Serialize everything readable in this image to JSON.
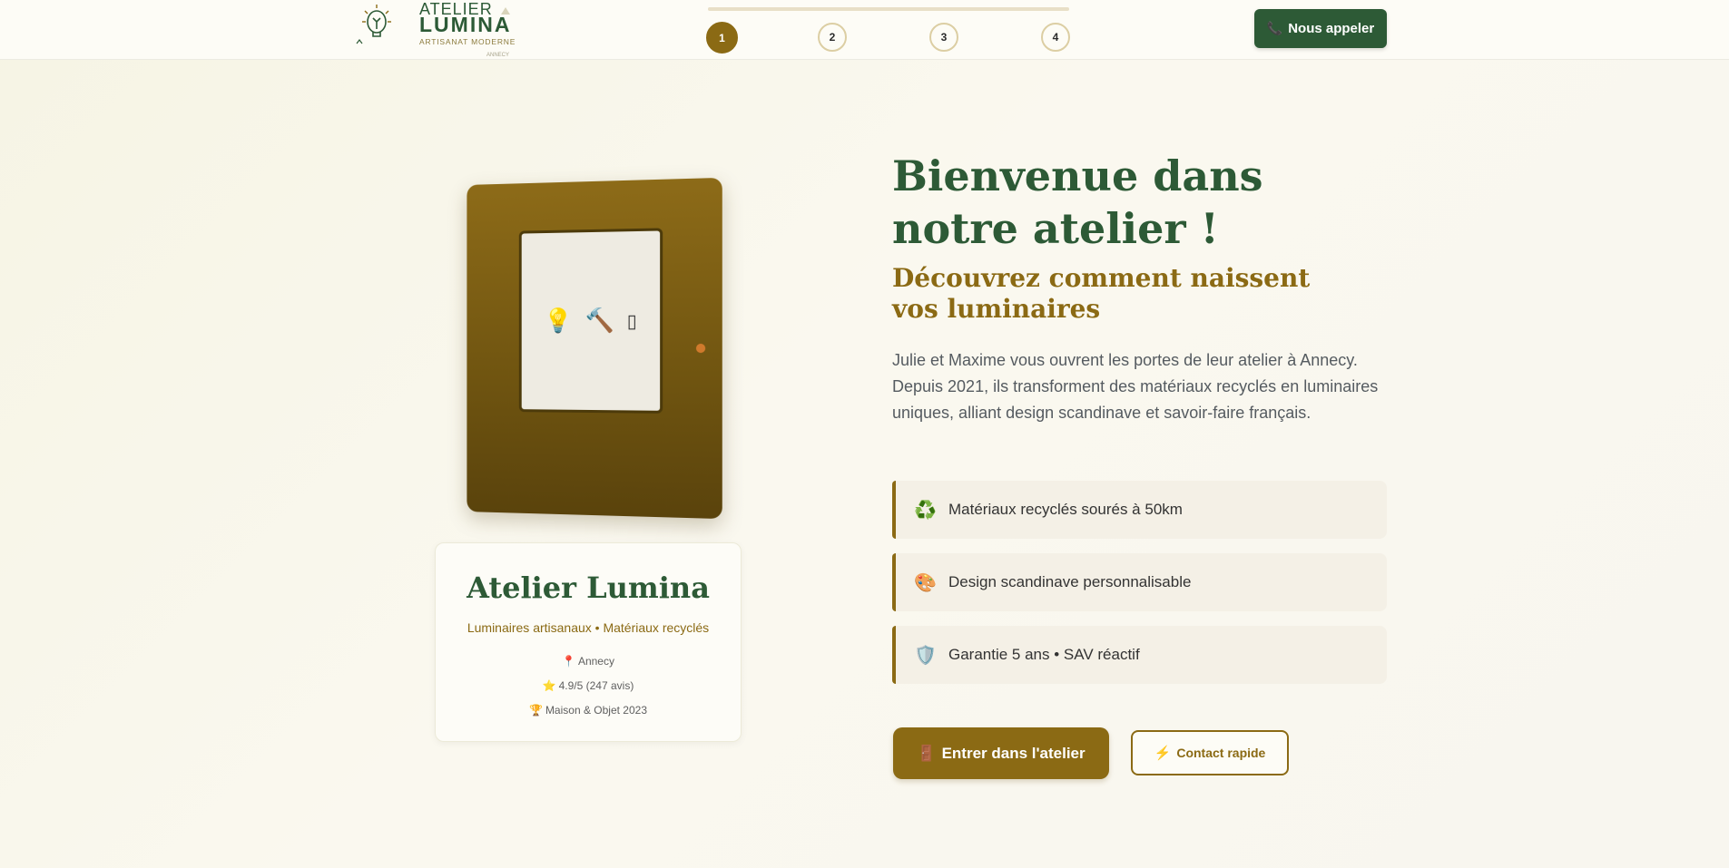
{
  "header": {
    "logo": {
      "line1": "ATELIER",
      "line2": "LUMINA",
      "tagline": "ARTISANAT MODERNE",
      "city": "ANNECY",
      "icon": "lightbulb-icon"
    },
    "steps": [
      "1",
      "2",
      "3",
      "4"
    ],
    "active_step": 1,
    "call_button": {
      "icon": "phone-icon",
      "label": "Nous appeler"
    }
  },
  "door": {
    "icons": [
      "💡",
      "🔨",
      "▯"
    ]
  },
  "card": {
    "title": "Atelier Lumina",
    "subtitle": "Luminaires artisanaux • Matériaux recyclés",
    "location": {
      "icon": "📍",
      "text": "Annecy"
    },
    "rating": {
      "icon": "⭐",
      "text": "4.9/5 (247 avis)"
    },
    "award": {
      "icon": "🏆",
      "text": "Maison & Objet 2023"
    }
  },
  "hero": {
    "title": "Bienvenue dans notre atelier !",
    "subtitle": "Découvrez comment naissent vos luminaires",
    "description": "Julie et Maxime vous ouvrent les portes de leur atelier à Annecy. Depuis 2021, ils transforment des matériaux recyclés en luminaires uniques, alliant design scandinave et savoir-faire français."
  },
  "features": [
    {
      "icon": "♻️",
      "text": "Matériaux recyclés sourés à 50km"
    },
    {
      "icon": "🎨",
      "text": "Design scandinave personnalisable"
    },
    {
      "icon": "🛡️",
      "text": "Garantie 5 ans • SAV réactif"
    }
  ],
  "actions": {
    "enter": {
      "icon": "🚪",
      "label": "Entrer dans l'atelier"
    },
    "contact": {
      "icon": "⚡",
      "label": "Contact rapide"
    }
  }
}
